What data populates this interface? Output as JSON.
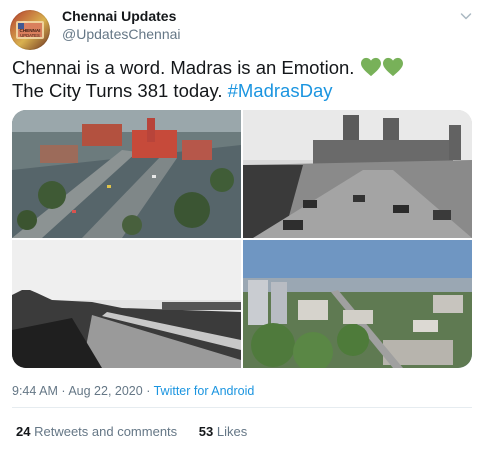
{
  "author": {
    "name": "Chennai Updates",
    "handle": "@UpdatesChennai",
    "avatar_text": "CHENNAI UPDATES"
  },
  "tweet": {
    "line1": "Chennai is a word. Madras is an Emotion.",
    "line2_prefix": "The City Turns 381 today.",
    "hashtag": "#MadrasDay",
    "emoji": [
      "green-heart",
      "green-heart"
    ]
  },
  "media": {
    "photos": [
      {
        "name": "Aerial view of Chennai Central station, color"
      },
      {
        "name": "Black and white street with domed building"
      },
      {
        "name": "Black and white marina road"
      },
      {
        "name": "Modern Chennai skyline aerial"
      }
    ]
  },
  "meta": {
    "time": "9:44 AM",
    "sep": "·",
    "date": "Aug 22, 2020",
    "source": "Twitter for Android"
  },
  "stats": {
    "retweets_count": "24",
    "retweets_label": "Retweets and comments",
    "likes_count": "53",
    "likes_label": "Likes"
  },
  "colors": {
    "accent": "#1b95e0",
    "heart": "#78b159",
    "secondary_text": "#657786"
  }
}
